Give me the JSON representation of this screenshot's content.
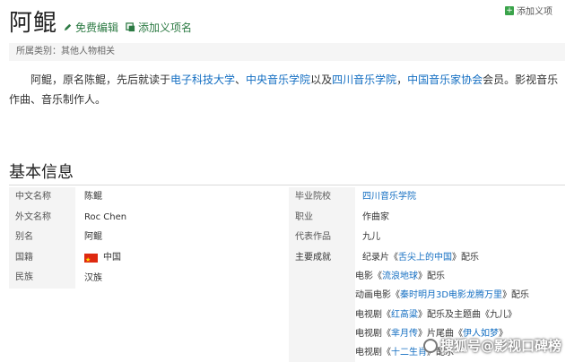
{
  "page": {
    "title": "阿鲲",
    "edit_label": "免费编辑",
    "add_meaning_label": "添加义项名",
    "add_entry_label": "添加义项"
  },
  "category": {
    "label": "所属类别：",
    "value": "其他人物相关"
  },
  "summary": {
    "p1": "阿鲲，原名陈鲲，先后就读于",
    "link1": "电子科技大学",
    "p2": "、",
    "link2": "中央音乐学院",
    "p3": "以及",
    "link3": "四川音乐学院",
    "p4": "，",
    "link4": "中国音乐家协会",
    "p5": "会员。影视音乐作曲、音乐制作人。"
  },
  "basic_info": {
    "title": "基本信息",
    "left": [
      {
        "key": "中文名称",
        "value": "陈鲲"
      },
      {
        "key": "外文名称",
        "value": "Roc Chen"
      },
      {
        "key": "别名",
        "value": "阿鲲"
      },
      {
        "key": "国籍",
        "value": "中国",
        "flag": true
      },
      {
        "key": "民族",
        "value": "汉族"
      }
    ],
    "right": [
      {
        "key": "毕业院校",
        "value": "四川音乐学院",
        "link": true
      },
      {
        "key": "职业",
        "value": "作曲家"
      },
      {
        "key": "代表作品",
        "value": "九儿"
      }
    ],
    "achievements_key": "主要成就",
    "achievements": [
      {
        "pre": "纪录片《",
        "link": "舌尖上的中国",
        "post": "》配乐"
      },
      {
        "pre": "电影《",
        "link": "流浪地球",
        "post": "》配乐"
      },
      {
        "pre": "动画电影《",
        "link": "秦时明月3D电影龙腾万里",
        "post": "》配乐"
      },
      {
        "pre": "电视剧《",
        "link": "红高粱",
        "post": "》配乐及主题曲《九儿》"
      },
      {
        "pre": "电视剧《",
        "link": "芈月传",
        "post": "》片尾曲《",
        "link2": "伊人如梦",
        "post2": "》"
      },
      {
        "pre": "电视剧《",
        "link": "十二生肖",
        "post": "》配乐"
      }
    ]
  },
  "watermark": {
    "text": "搜狐号@影视口碑榜"
  },
  "colors": {
    "link": "#136ec2",
    "action_green": "#2c7a43",
    "key_bg": "#f4f4f4"
  }
}
